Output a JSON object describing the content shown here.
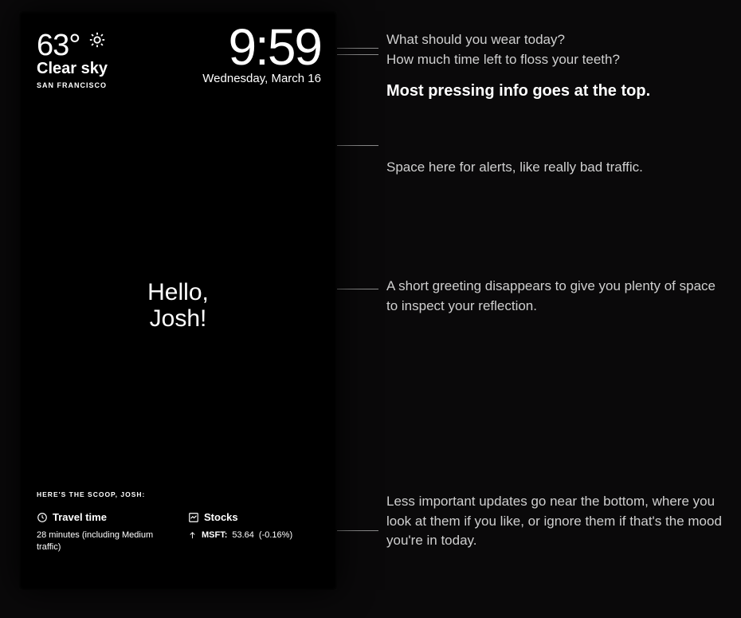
{
  "weather": {
    "temp": "63°",
    "condition": "Clear sky",
    "city": "SAN FRANCISCO"
  },
  "clock": {
    "time": "9:59",
    "date": "Wednesday, March 16"
  },
  "greeting": {
    "line1": "Hello,",
    "line2": "Josh!"
  },
  "scoop": {
    "title": "HERE'S THE SCOOP, JOSH:",
    "travel": {
      "label": "Travel time",
      "body": "28 minutes (including Medium traffic)"
    },
    "stocks": {
      "label": "Stocks",
      "symbol": "MSFT:",
      "price": "53.64",
      "change": "(-0.16%)"
    }
  },
  "annotations": {
    "q1": "What should you wear today?",
    "q2": "How much time left to floss your teeth?",
    "headline": "Most pressing info goes at the top.",
    "alerts": "Space here for alerts, like really bad traffic.",
    "greeting_note": "A short greeting disappears to give you plenty of space to inspect your reflection.",
    "bottom_note": "Less important updates go near the bottom, where you look at them if you like, or ignore them if that's the mood you're in today."
  }
}
